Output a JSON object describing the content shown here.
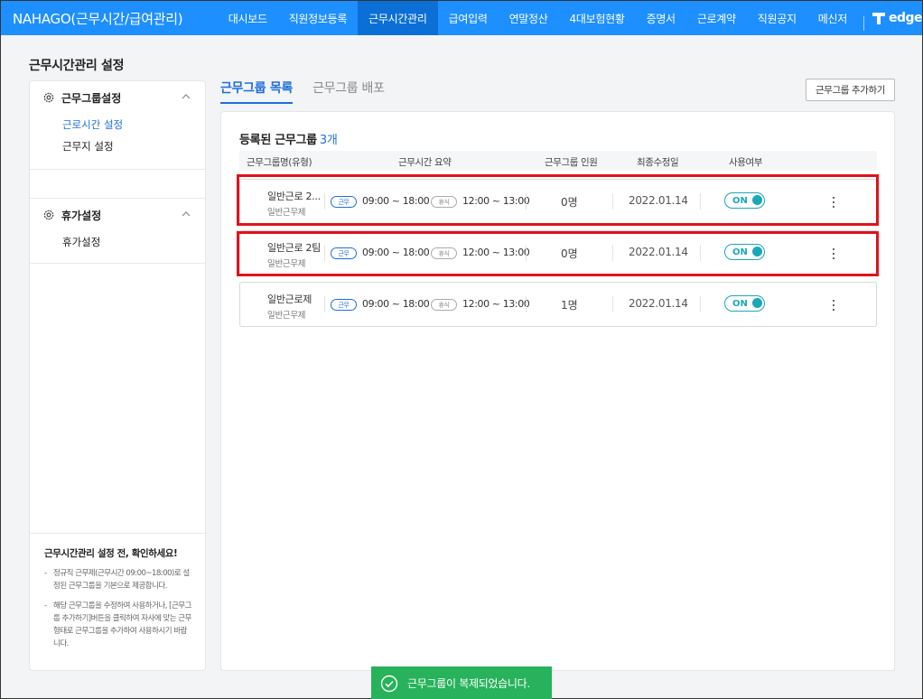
{
  "app": {
    "title": "NAHAGO(근무시간/급여관리)",
    "nav": [
      "대시보드",
      "직원정보등록",
      "근무시간관리",
      "급여입력",
      "연말정산",
      "4대보험현황",
      "증명서",
      "근로계약",
      "직원공지",
      "메신저"
    ],
    "active_nav": "근무시간관리",
    "partner_logo": "T edge",
    "accent": "#1e8fff"
  },
  "page": {
    "title": "근무시간관리 설정"
  },
  "sidebar": {
    "sections": [
      {
        "title": "근무그룹설정",
        "icon": "gear-icon",
        "items": [
          "근로시간 설정",
          "근무지 설정"
        ],
        "active_item": "근로시간 설정"
      },
      {
        "title": "휴가설정",
        "icon": "gear-icon",
        "items": [
          "휴가설정"
        ]
      }
    ],
    "notice": {
      "title": "근무시간관리 설정 전, 확인하세요!",
      "items": [
        "정규직 근무제(근무시간 09:00~18:00)로 설정된 근무그룹을 기본으로 제공합니다.",
        "해당 근무그룹을 수정하여 사용하거나, [근무그룹 추가하기]버튼을 클릭하여 자사에 맞는 근무형태로 근무그룹을 추가하여 사용하시기 바랍니다."
      ]
    }
  },
  "tabs": [
    "근무그룹 목록",
    "근무그룹 배포"
  ],
  "add_group_button": "근무그룹 추가하기",
  "list": {
    "title": "등록된 근무그룹",
    "count": "3개",
    "columns": [
      "근무그룹명(유형)",
      "근무시간 요약",
      "근무그룹 인원",
      "최종수정일",
      "사용여부"
    ],
    "work_tag": "근무",
    "rest_tag": "휴식",
    "rows": [
      {
        "name": "일반근로 2...",
        "type": "일반근무제",
        "work_time": "09:00 ~ 18:00",
        "rest_time": "12:00 ~ 13:00",
        "members": "0명",
        "date": "2022.01.14",
        "status": "ON",
        "highlighted": true
      },
      {
        "name": "일반근로 2팀",
        "type": "일반근무제",
        "work_time": "09:00 ~ 18:00",
        "rest_time": "12:00 ~ 13:00",
        "members": "0명",
        "date": "2022.01.14",
        "status": "ON",
        "highlighted": true
      },
      {
        "name": "일반근로제",
        "type": "일반근무제",
        "work_time": "09:00 ~ 18:00",
        "rest_time": "12:00 ~ 13:00",
        "members": "1명",
        "date": "2022.01.14",
        "status": "ON",
        "highlighted": false
      }
    ]
  },
  "toast": {
    "message": "근무그룹이 복제되었습니다.",
    "color": "#27b25b"
  }
}
